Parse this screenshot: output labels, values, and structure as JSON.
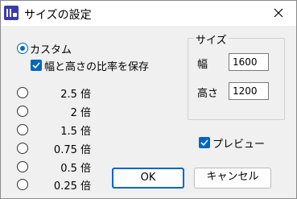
{
  "window": {
    "title": "サイズの設定",
    "app_icon": "app-icon",
    "close_icon": "close-icon"
  },
  "mode": {
    "custom_label": "カスタム",
    "custom_selected": true,
    "keep_ratio_label": "幅と高さの比率を保存",
    "keep_ratio_checked": true
  },
  "scales": [
    {
      "label": "2.5 倍",
      "selected": false
    },
    {
      "label": "2 倍",
      "selected": false
    },
    {
      "label": "1.5 倍",
      "selected": false
    },
    {
      "label": "0.75 倍",
      "selected": false
    },
    {
      "label": "0.5 倍",
      "selected": false
    },
    {
      "label": "0.25 倍",
      "selected": false
    }
  ],
  "size_group": {
    "title": "サイズ",
    "width_label": "幅",
    "width_value": "1600",
    "height_label": "高さ",
    "height_value": "1200"
  },
  "preview": {
    "label": "プレビュー",
    "checked": true
  },
  "buttons": {
    "ok": "OK",
    "cancel": "キャンセル"
  },
  "colors": {
    "accent": "#0067c0",
    "background": "#f0f0f0"
  }
}
